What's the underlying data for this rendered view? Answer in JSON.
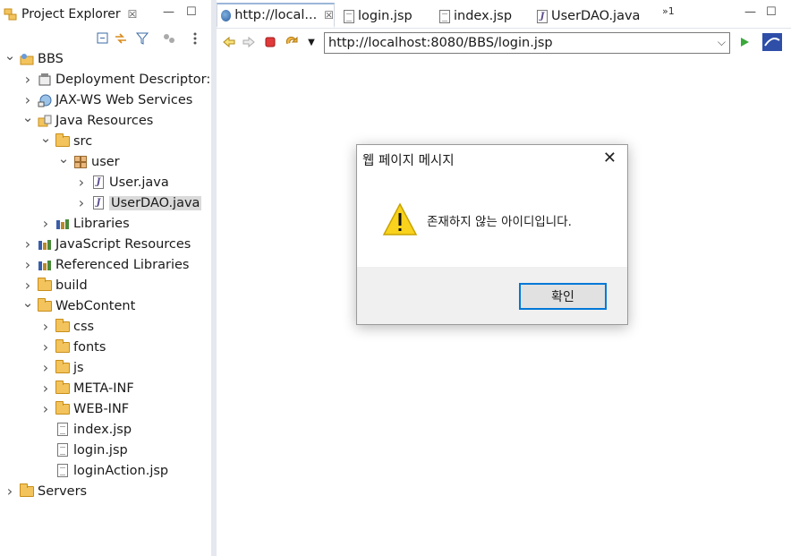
{
  "left_view": {
    "tab_label": "Project Explorer",
    "tab_close": "☒",
    "minimize": "—",
    "maximize": "☐"
  },
  "tree": [
    {
      "label": "BBS",
      "depth": 0,
      "twisty": "expanded",
      "icon": "project-icon"
    },
    {
      "label": "Deployment Descriptor: B",
      "depth": 1,
      "twisty": "collapsed",
      "icon": "deployment-descriptor-icon"
    },
    {
      "label": "JAX-WS Web Services",
      "depth": 1,
      "twisty": "collapsed",
      "icon": "web-services-icon"
    },
    {
      "label": "Java Resources",
      "depth": 1,
      "twisty": "expanded",
      "icon": "java-resources-icon"
    },
    {
      "label": "src",
      "depth": 2,
      "twisty": "expanded",
      "icon": "source-folder-icon"
    },
    {
      "label": "user",
      "depth": 3,
      "twisty": "expanded",
      "icon": "package-icon"
    },
    {
      "label": "User.java",
      "depth": 4,
      "twisty": "collapsed",
      "icon": "java-file-icon"
    },
    {
      "label": "UserDAO.java",
      "depth": 4,
      "twisty": "collapsed",
      "icon": "java-file-icon",
      "selected": true
    },
    {
      "label": "Libraries",
      "depth": 2,
      "twisty": "collapsed",
      "icon": "library-icon"
    },
    {
      "label": "JavaScript Resources",
      "depth": 1,
      "twisty": "collapsed",
      "icon": "library-icon"
    },
    {
      "label": "Referenced Libraries",
      "depth": 1,
      "twisty": "collapsed",
      "icon": "library-icon"
    },
    {
      "label": "build",
      "depth": 1,
      "twisty": "collapsed",
      "icon": "folder-icon"
    },
    {
      "label": "WebContent",
      "depth": 1,
      "twisty": "expanded",
      "icon": "folder-open-icon"
    },
    {
      "label": "css",
      "depth": 2,
      "twisty": "collapsed",
      "icon": "folder-icon"
    },
    {
      "label": "fonts",
      "depth": 2,
      "twisty": "collapsed",
      "icon": "folder-icon"
    },
    {
      "label": "js",
      "depth": 2,
      "twisty": "collapsed",
      "icon": "folder-icon"
    },
    {
      "label": "META-INF",
      "depth": 2,
      "twisty": "collapsed",
      "icon": "folder-icon"
    },
    {
      "label": "WEB-INF",
      "depth": 2,
      "twisty": "collapsed",
      "icon": "folder-icon"
    },
    {
      "label": "index.jsp",
      "depth": 2,
      "twisty": "none",
      "icon": "jsp-file-icon"
    },
    {
      "label": "login.jsp",
      "depth": 2,
      "twisty": "none",
      "icon": "jsp-file-icon"
    },
    {
      "label": "loginAction.jsp",
      "depth": 2,
      "twisty": "none",
      "icon": "jsp-file-icon"
    },
    {
      "label": "Servers",
      "depth": 0,
      "twisty": "collapsed",
      "icon": "folder-icon"
    }
  ],
  "editor": {
    "tabs": [
      {
        "label": "http://local...",
        "active": true,
        "icon": "globe-icon"
      },
      {
        "label": "login.jsp",
        "icon": "jsp-file-icon"
      },
      {
        "label": "index.jsp",
        "icon": "jsp-file-icon"
      },
      {
        "label": "UserDAO.java",
        "icon": "java-file-icon"
      }
    ],
    "overflow_label": "»1",
    "url": "http://localhost:8080/BBS/login.jsp"
  },
  "dialog": {
    "title": "웹 페이지 메시지",
    "message": "존재하지 않는 아이디입니다.",
    "ok_label": "확인",
    "close_glyph": "✕"
  },
  "colors": {
    "warning_yellow": "#f8d21c",
    "accent_blue": "#0078d7",
    "selection_gray": "#dadada"
  }
}
